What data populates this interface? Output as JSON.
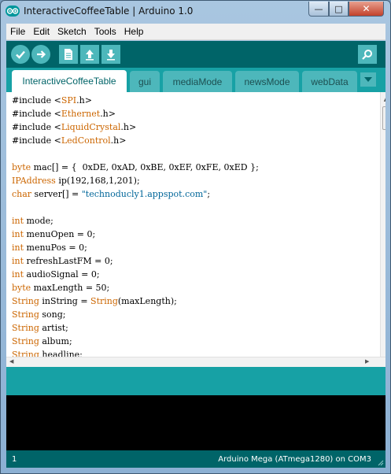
{
  "window": {
    "title": "InteractiveCoffeeTable | Arduino 1.0",
    "controls": {
      "minimize": "—",
      "maximize": "□",
      "close": "✕"
    }
  },
  "menu": [
    "File",
    "Edit",
    "Sketch",
    "Tools",
    "Help"
  ],
  "toolbar": {
    "buttons": [
      {
        "name": "verify",
        "icon": "checkmark-icon"
      },
      {
        "name": "upload",
        "icon": "arrow-right-icon"
      },
      {
        "name": "new",
        "icon": "new-file-icon"
      },
      {
        "name": "open",
        "icon": "arrow-up-icon"
      },
      {
        "name": "save",
        "icon": "arrow-down-icon"
      }
    ],
    "serial_monitor_icon": "magnifier-icon"
  },
  "tabs": [
    {
      "label": "InteractiveCoffeeTable",
      "active": true
    },
    {
      "label": "gui",
      "active": false
    },
    {
      "label": "mediaMode",
      "active": false
    },
    {
      "label": "newsMode",
      "active": false
    },
    {
      "label": "webData",
      "active": false
    }
  ],
  "code": [
    [
      {
        "t": "#include <"
      },
      {
        "t": "SPI",
        "c": "kw"
      },
      {
        "t": ".h>"
      }
    ],
    [
      {
        "t": "#include <"
      },
      {
        "t": "Ethernet",
        "c": "kw"
      },
      {
        "t": ".h>"
      }
    ],
    [
      {
        "t": "#include <"
      },
      {
        "t": "LiquidCrystal",
        "c": "kw"
      },
      {
        "t": ".h>"
      }
    ],
    [
      {
        "t": "#include <"
      },
      {
        "t": "LedControl",
        "c": "kw"
      },
      {
        "t": ".h>"
      }
    ],
    [],
    [
      {
        "t": "byte",
        "c": "kw"
      },
      {
        "t": " mac[] = {  0xDE, 0xAD, 0xBE, 0xEF, 0xFE, 0xED };"
      }
    ],
    [
      {
        "t": "IPAddress",
        "c": "kw"
      },
      {
        "t": " ip(192,168,1,201);"
      }
    ],
    [
      {
        "t": "char",
        "c": "kw"
      },
      {
        "t": " server[] = "
      },
      {
        "t": "\"technoducly1.appspot.com\"",
        "c": "str"
      },
      {
        "t": ";"
      }
    ],
    [],
    [
      {
        "t": "int",
        "c": "kw"
      },
      {
        "t": " mode;"
      }
    ],
    [
      {
        "t": "int",
        "c": "kw"
      },
      {
        "t": " menuOpen = 0;"
      }
    ],
    [
      {
        "t": "int",
        "c": "kw"
      },
      {
        "t": " menuPos = 0;"
      }
    ],
    [
      {
        "t": "int",
        "c": "kw"
      },
      {
        "t": " refreshLastFM = 0;"
      }
    ],
    [
      {
        "t": "int",
        "c": "kw"
      },
      {
        "t": " audioSignal = 0;"
      }
    ],
    [
      {
        "t": "byte",
        "c": "kw"
      },
      {
        "t": " maxLength = 50;"
      }
    ],
    [
      {
        "t": "String",
        "c": "kw"
      },
      {
        "t": " inString = "
      },
      {
        "t": "String",
        "c": "kw"
      },
      {
        "t": "(maxLength);"
      }
    ],
    [
      {
        "t": "String",
        "c": "kw"
      },
      {
        "t": " song;"
      }
    ],
    [
      {
        "t": "String",
        "c": "kw"
      },
      {
        "t": " artist;"
      }
    ],
    [
      {
        "t": "String",
        "c": "kw"
      },
      {
        "t": " album;"
      }
    ],
    [
      {
        "t": "String",
        "c": "kw"
      },
      {
        "t": " headline;"
      }
    ]
  ],
  "status": {
    "line": "1",
    "board": "Arduino Mega (ATmega1280) on COM3"
  },
  "colors": {
    "toolbar": "#006468",
    "tabbar": "#17a1a5",
    "keyword": "#cc6600",
    "string": "#006699"
  }
}
